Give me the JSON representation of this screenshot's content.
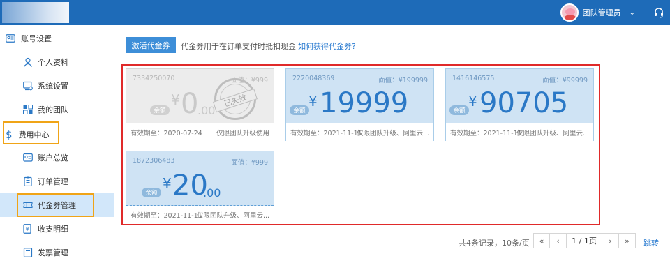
{
  "header": {
    "user_name": "团队管理员",
    "dropdown_glyph": "⌄",
    "icons": [
      "avatar",
      "chevron-down-icon",
      "headset-icon"
    ]
  },
  "sidebar": {
    "group_account": "账号设置",
    "items_account": [
      {
        "label": "个人资料",
        "icon": "user-icon"
      },
      {
        "label": "系统设置",
        "icon": "settings-icon"
      },
      {
        "label": "我的团队",
        "icon": "team-icon"
      }
    ],
    "group_fee": "费用中心",
    "items_fee": [
      {
        "label": "账户总览",
        "icon": "account-card-icon"
      },
      {
        "label": "订单管理",
        "icon": "clipboard-icon"
      },
      {
        "label": "代金券管理",
        "icon": "ticket-icon",
        "active": true
      },
      {
        "label": "收支明细",
        "icon": "yuan-icon"
      },
      {
        "label": "发票管理",
        "icon": "invoice-icon"
      }
    ]
  },
  "toolbar": {
    "activate_label": "激活代金券",
    "hint": "代金券用于在订单支付时抵扣现金",
    "howto_link": "如何获得代金券?"
  },
  "vouchers": [
    {
      "id": "7334250070",
      "face": "面值：¥999",
      "balance_label": "余额",
      "currency": "¥",
      "amount": "0",
      "cents": ".00",
      "valid": "有效期至：2020-07-24",
      "scope": "仅限团队升级使用",
      "status": "expired",
      "stamp": "已失效"
    },
    {
      "id": "2220048369",
      "face": "面值：¥199999",
      "balance_label": "余额",
      "currency": "¥",
      "amount": "19999",
      "cents": "",
      "valid": "有效期至：2021-11-11",
      "scope": "仅限团队升级、阿里云...",
      "status": "active"
    },
    {
      "id": "1416146575",
      "face": "面值：¥99999",
      "balance_label": "余额",
      "currency": "¥",
      "amount": "90705",
      "cents": "",
      "valid": "有效期至：2021-11-11",
      "scope": "仅限团队升级、阿里云...",
      "status": "active"
    },
    {
      "id": "1872306483",
      "face": "面值：¥999",
      "balance_label": "余额",
      "currency": "¥",
      "amount": "20",
      "cents": ".00",
      "valid": "有效期至：2021-11-11",
      "scope": "仅限团队升级、阿里云...",
      "status": "active"
    }
  ],
  "pager": {
    "info": "共4条记录，10条/页",
    "first": "«",
    "prev": "‹",
    "current": "1 / 1页",
    "next": "›",
    "last": "»",
    "jump": "跳转"
  },
  "colors": {
    "header": "#1e6bb8",
    "accent": "#3d8ed8",
    "highlight_orange": "#f0a417",
    "highlight_red": "#e02a2a",
    "card_bg": "#cfe3f4"
  }
}
